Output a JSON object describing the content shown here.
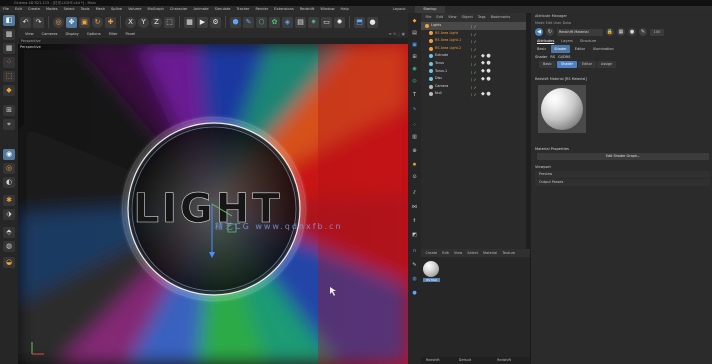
{
  "window": {
    "title": "Cinema 4D R21.115 - [灯光-LIGHT.c4d *] - Main"
  },
  "menubar": {
    "items": [
      "File",
      "Edit",
      "Create",
      "Modes",
      "Select",
      "Tools",
      "Mesh",
      "Spline",
      "Volume",
      "MoGraph",
      "Character",
      "Animate",
      "Simulate",
      "Tracker",
      "Render",
      "Extensions",
      "Redshift",
      "Window",
      "Help"
    ],
    "layout_label": "Layout:",
    "layout_value": "Startup"
  },
  "viewport": {
    "menu": [
      "View",
      "Cameras",
      "Display",
      "Options",
      "Filter",
      "Panel"
    ],
    "submenu": "Perspective",
    "label": "Perspective",
    "nav_icons": "⬌ ⟲ ⬚ ▣",
    "watermark": "精艺CG  www.qdnxfb.cn",
    "scene_text": "LIGHT"
  },
  "toolbar": {
    "icons": [
      "undo-icon",
      "redo-icon",
      "live-select-icon",
      "move-icon",
      "scale-icon",
      "rotate-icon",
      "axis-x-icon",
      "axis-y-icon",
      "axis-z-icon",
      "world-coord-icon",
      "render-view-icon",
      "render-picture-queue-icon",
      "render-settings-icon",
      "cube-icon",
      "pen-icon",
      "subdivision-icon",
      "cloner-icon",
      "deformer-icon",
      "scene-icon",
      "camera-icon",
      "light-icon"
    ]
  },
  "object_manager": {
    "menu": [
      "File",
      "Edit",
      "View",
      "Object",
      "Tags",
      "Bookmarks"
    ],
    "objects": [
      {
        "name": "Lights",
        "color": "#f2a03c",
        "selected": true,
        "orange": false
      },
      {
        "name": "RS Area Light",
        "color": "#f2a03c",
        "selected": false,
        "orange": true
      },
      {
        "name": "RS Area Light.1",
        "color": "#f2a03c",
        "selected": false,
        "orange": true
      },
      {
        "name": "RS Area Light.2",
        "color": "#f2a03c",
        "selected": false,
        "orange": true
      },
      {
        "name": "Extrude",
        "color": "#67c8e8",
        "selected": false,
        "orange": false
      },
      {
        "name": "Torus",
        "color": "#67c8e8",
        "selected": false,
        "orange": false
      },
      {
        "name": "Torus.1",
        "color": "#67c8e8",
        "selected": false,
        "orange": false
      },
      {
        "name": "Disc",
        "color": "#67c8e8",
        "selected": false,
        "orange": false
      },
      {
        "name": "Camera",
        "color": "#bbbbbb",
        "selected": false,
        "orange": false
      },
      {
        "name": "Null",
        "color": "#bbbbbb",
        "selected": false,
        "orange": false
      }
    ]
  },
  "material_manager": {
    "menu": [
      "Create",
      "Edit",
      "View",
      "Select",
      "Material",
      "Texture"
    ],
    "material_label": "RS Mat",
    "status": [
      "Redshift",
      "Default",
      "Redshift"
    ]
  },
  "attribute_manager": {
    "title": "Attribute Manager",
    "mode": "Mode  Edit  User Data",
    "select_value": "Redshift Material",
    "zoom_value": "100",
    "tabs": [
      "Attributes",
      "Layers",
      "Structure"
    ],
    "subtabs": [
      "Basic",
      "Shader",
      "Editor",
      "Illumination"
    ],
    "redshift_label": "Shader",
    "redshift_opts": [
      "RS",
      "GI/DRS"
    ],
    "inner_tabs": [
      "Basic",
      "Shader",
      "Editor",
      "Assign"
    ],
    "material_name_row": "Redshift Material [RS Material]",
    "section_title": "Material Properties",
    "shader_graph_button": "Edit Shader Graph...",
    "overlay_title": "Viewport",
    "sections": [
      "Preview",
      "Output Passes"
    ]
  }
}
